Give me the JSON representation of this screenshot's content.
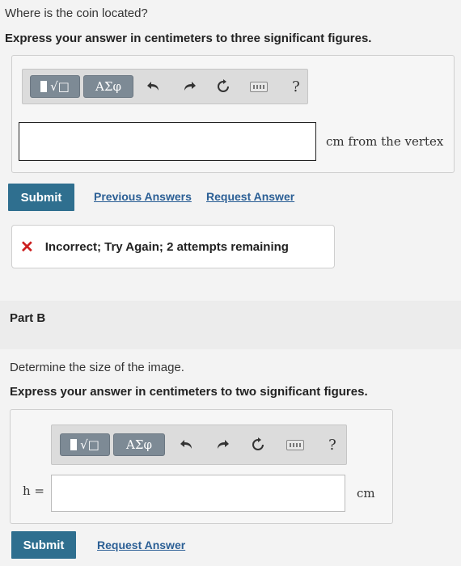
{
  "part_a": {
    "question": "Where is the coin located?",
    "instruction": "Express your answer in centimeters to three significant figures.",
    "toolbar": {
      "templates_label": "√□",
      "greek_label": "ΑΣφ",
      "help_label": "?"
    },
    "answer_value": "",
    "unit": "cm from the vertex",
    "submit_label": "Submit",
    "previous_answers_label": "Previous Answers",
    "request_answer_label": "Request Answer",
    "feedback": "Incorrect; Try Again; 2 attempts remaining",
    "feedback_icon": "✕"
  },
  "part_b": {
    "title": "Part B",
    "question": "Determine the size of the image.",
    "instruction": "Express your answer in centimeters to two significant figures.",
    "toolbar": {
      "templates_label": "√□",
      "greek_label": "ΑΣφ",
      "help_label": "?"
    },
    "variable_label": "h =",
    "answer_value": "",
    "unit": "cm",
    "submit_label": "Submit",
    "request_answer_label": "Request Answer"
  },
  "colors": {
    "submit_bg": "#2f6f8f",
    "link": "#2b5f95",
    "error": "#cc1f1f",
    "toolbar_btn": "#7d8a95"
  }
}
